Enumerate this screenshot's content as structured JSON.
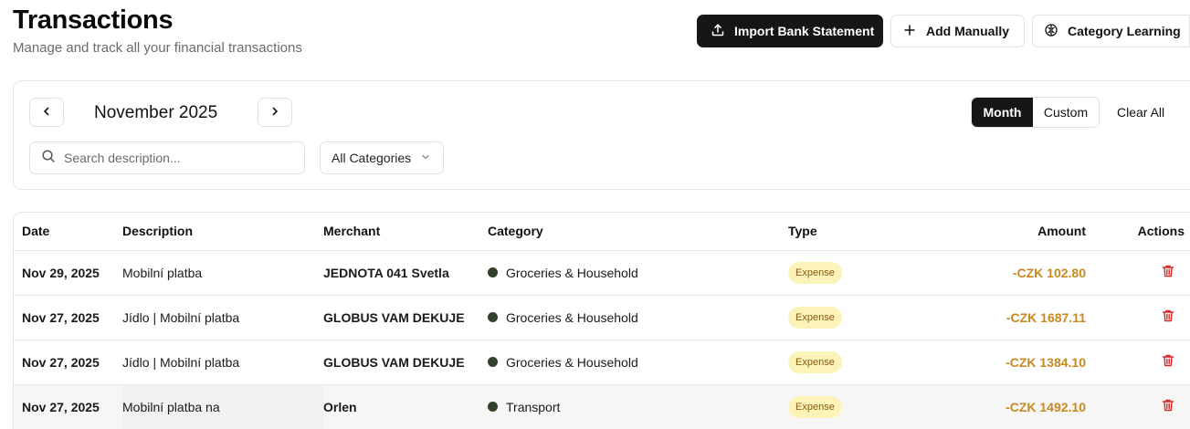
{
  "header": {
    "title": "Transactions",
    "subtitle": "Manage and track all your financial transactions"
  },
  "actions": {
    "import_label": "Import Bank Statement",
    "add_label": "Add Manually",
    "learning_label": "Category Learning"
  },
  "filters": {
    "month": "November 2025",
    "mode_month": "Month",
    "mode_custom": "Custom",
    "active_mode": "Month",
    "clear_label": "Clear All",
    "search_placeholder": "Search description...",
    "category_selected": "All Categories"
  },
  "table": {
    "headers": {
      "date": "Date",
      "description": "Description",
      "merchant": "Merchant",
      "category": "Category",
      "type": "Type",
      "amount": "Amount",
      "actions": "Actions"
    },
    "rows": [
      {
        "date": "Nov 29, 2025",
        "description": "Mobilní platba",
        "merchant": "JEDNOTA 041 Svetla",
        "category": "Groceries & Household",
        "type": "Expense",
        "amount": "-CZK 102.80"
      },
      {
        "date": "Nov 27, 2025",
        "description": "Jídlo | Mobilní platba",
        "merchant": "GLOBUS VAM DEKUJE",
        "category": "Groceries & Household",
        "type": "Expense",
        "amount": "-CZK 1687.11"
      },
      {
        "date": "Nov 27, 2025",
        "description": "Jídlo | Mobilní platba",
        "merchant": "GLOBUS VAM DEKUJE",
        "category": "Groceries & Household",
        "type": "Expense",
        "amount": "-CZK 1384.10"
      },
      {
        "date": "Nov 27, 2025",
        "description": "Mobilní platba na",
        "merchant": "Orlen",
        "category": "Transport",
        "type": "Expense",
        "amount": "-CZK 1492.10"
      }
    ]
  },
  "colors": {
    "primary_dark": "#161616",
    "expense_amount": "#c9891f",
    "expense_badge_bg": "#fcf3b8",
    "delete_icon": "#d62828",
    "category_dot": "#33402a"
  },
  "icons": {
    "import": "upload-icon",
    "add": "plus-icon",
    "learning": "brain-icon",
    "prev": "chevron-left-icon",
    "next": "chevron-right-icon",
    "search": "search-icon",
    "select": "chevron-down-icon",
    "delete": "trash-icon"
  }
}
